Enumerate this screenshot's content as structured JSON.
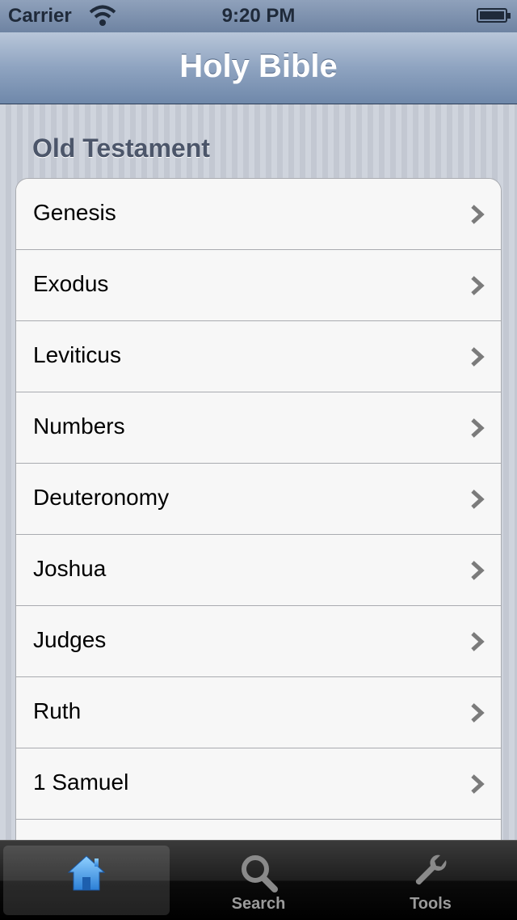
{
  "status_bar": {
    "carrier": "Carrier",
    "time": "9:20 PM",
    "wifi_icon": "wifi-icon",
    "battery_icon": "battery-icon"
  },
  "nav_bar": {
    "title": "Holy Bible"
  },
  "section": {
    "header": "Old Testament",
    "items": [
      {
        "label": "Genesis"
      },
      {
        "label": "Exodus"
      },
      {
        "label": "Leviticus"
      },
      {
        "label": "Numbers"
      },
      {
        "label": "Deuteronomy"
      },
      {
        "label": "Joshua"
      },
      {
        "label": "Judges"
      },
      {
        "label": "Ruth"
      },
      {
        "label": "1 Samuel"
      },
      {
        "label": ""
      }
    ]
  },
  "tab_bar": {
    "tabs": [
      {
        "label": "",
        "icon": "home-icon",
        "selected": true
      },
      {
        "label": "Search",
        "icon": "search-icon",
        "selected": false
      },
      {
        "label": "Tools",
        "icon": "wrench-icon",
        "selected": false
      }
    ]
  },
  "colors": {
    "nav_bar": "#8ea3c0",
    "tab_selected_icon": "#4aa3ee",
    "tab_label": "#9b9b9b"
  }
}
